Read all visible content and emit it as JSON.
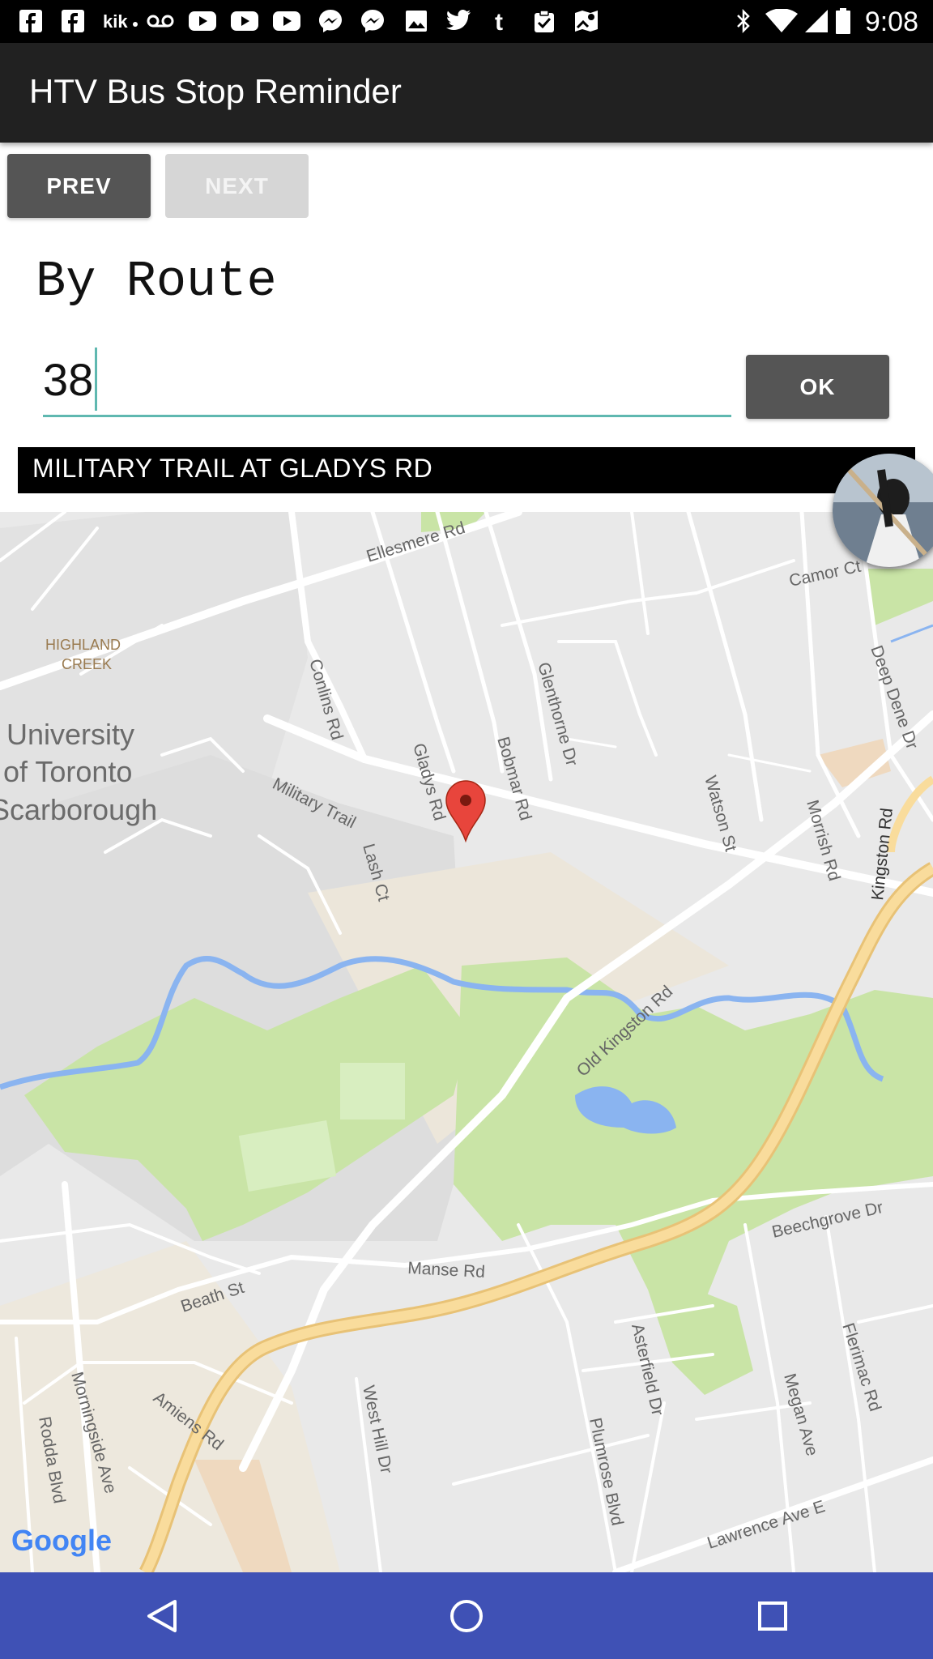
{
  "status_bar": {
    "time": "9:08",
    "left_icons": [
      "facebook-icon",
      "facebook-icon",
      "kik-icon",
      "voicemail-icon",
      "youtube-icon",
      "youtube-icon",
      "youtube-icon",
      "messenger-icon",
      "messenger-icon",
      "image-icon",
      "twitter-icon",
      "tumblr-icon",
      "clipboard-check-icon",
      "maps-icon"
    ],
    "right_icons": [
      "bluetooth-icon",
      "wifi-icon",
      "signal-icon",
      "battery-icon"
    ]
  },
  "app_bar": {
    "title": "HTV Bus Stop Reminder"
  },
  "nav": {
    "prev_label": "PREV",
    "next_label": "NEXT"
  },
  "mode": {
    "label": "By Route"
  },
  "route_input": {
    "value": "38"
  },
  "ok_label": "OK",
  "stop": {
    "name": "MILITARY TRAIL AT GLADYS RD"
  },
  "map": {
    "labels": {
      "ellesmere": "Ellesmere Rd",
      "camor": "Camor Ct",
      "highland1": "HIGHLAND",
      "highland2": "CREEK",
      "uoft1": "University",
      "uoft2": "of Toronto",
      "uoft3": "Scarborough",
      "conlins": "Conlins Rd",
      "gladys": "Gladys Rd",
      "bobmar": "Bobmar Rd",
      "glenthorne": "Glenthorne Dr",
      "watson": "Watson St",
      "morrish": "Morrish Rd",
      "kingston": "Kingston Rd",
      "deepdene": "Deep Dene Dr",
      "military": "Military Trail",
      "lash": "Lash Ct",
      "oldkingston": "Old Kingston Rd",
      "beechgrove": "Beechgrove Dr",
      "manse": "Manse Rd",
      "beath": "Beath St",
      "asterfield": "Asterfield Dr",
      "meganave": "Megan Ave",
      "flerimac": "Flerimac Rd",
      "morningside": "Morningside Ave",
      "amiens": "Amiens Rd",
      "westhill": "West Hill Dr",
      "plumrose": "Plumrose Blvd",
      "rodda": "Rodda Blvd",
      "lawrence": "Lawrence Ave E"
    },
    "attribution": "Google",
    "colors": {
      "park": "#c9e4a6",
      "water": "#8ab4f0",
      "highway": "#f7d48b",
      "road": "#ffffff",
      "campus": "#dcdcdc"
    }
  },
  "system_nav": {
    "icons": [
      "back-icon",
      "home-icon",
      "recents-icon"
    ]
  },
  "colors": {
    "accent": "#5fb8b0",
    "nav_bar": "#3f51b5",
    "app_bar": "#212121",
    "button": "#555555"
  }
}
